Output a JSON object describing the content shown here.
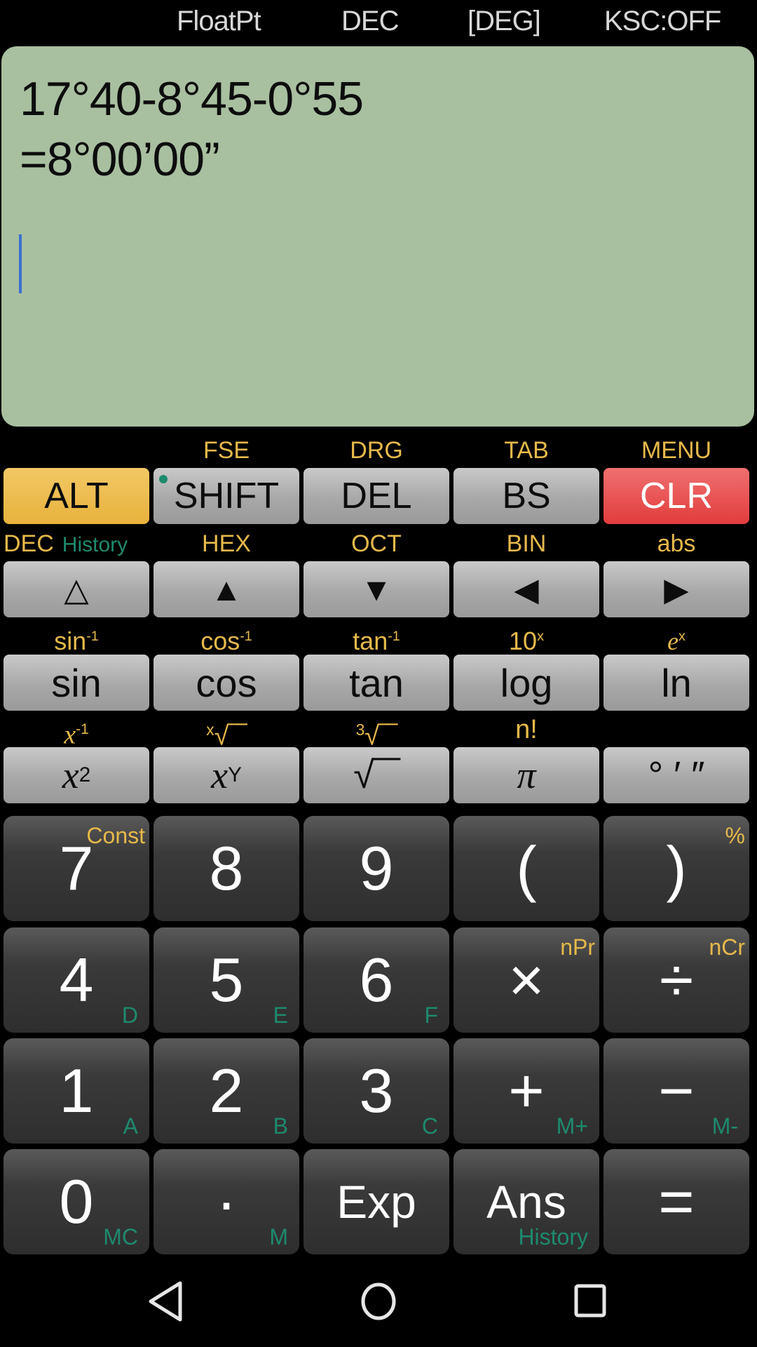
{
  "status_bar": {
    "float_mode": "FloatPt",
    "number_base": "DEC",
    "angle_mode": "[DEG]",
    "ksc": "KSC:OFF"
  },
  "display": {
    "expression": "17°40-8°45-0°55",
    "result": "=8°00’00”"
  },
  "colors": {
    "display_bg": "#a8c0a0",
    "alt_key": "#e8b23c",
    "clr_key": "#e23c3c",
    "gold_label": "#e6b94a",
    "teal_label": "#1d8a6e",
    "cursor": "#3a6fd0"
  },
  "row1": {
    "labels": [
      "",
      "FSE",
      "DRG",
      "TAB",
      "MENU"
    ],
    "keys": [
      "ALT",
      "SHIFT",
      "DEL",
      "BS",
      "CLR"
    ]
  },
  "row2": {
    "labels": [
      "DEC",
      "HEX",
      "OCT",
      "BIN",
      "abs"
    ],
    "label_extra": "History",
    "keys": [
      "△",
      "▲",
      "▼",
      "◀",
      "▶"
    ],
    "icons": [
      "outline-up-triangle-icon",
      "up-arrow-icon",
      "down-arrow-icon",
      "left-arrow-icon",
      "right-arrow-icon"
    ]
  },
  "row3": {
    "labels": [
      {
        "base": "sin",
        "sup": "-1"
      },
      {
        "base": "cos",
        "sup": "-1"
      },
      {
        "base": "tan",
        "sup": "-1"
      },
      {
        "base": "10",
        "sup": "x"
      },
      {
        "base": "e",
        "sup": "x"
      }
    ],
    "keys": [
      "sin",
      "cos",
      "tan",
      "log",
      "ln"
    ]
  },
  "row4": {
    "labels": [
      {
        "base": "x",
        "sup": "-1"
      },
      {
        "pre": "x",
        "base": "√‾‾"
      },
      {
        "pre": "3",
        "base": "√‾‾"
      },
      {
        "base": "n!"
      },
      {
        "base": ""
      }
    ],
    "keys": [
      {
        "base": "x",
        "sup": "2"
      },
      {
        "base": "x",
        "sup": "Y"
      },
      {
        "base": "√‾‾"
      },
      {
        "base": "π"
      },
      {
        "base": "° ′ ″"
      }
    ]
  },
  "digits": [
    [
      {
        "main": "7",
        "gold": "Const",
        "teal": ""
      },
      {
        "main": "8",
        "gold": "",
        "teal": ""
      },
      {
        "main": "9",
        "gold": "",
        "teal": ""
      },
      {
        "main": "(",
        "gold": "",
        "teal": ""
      },
      {
        "main": ")",
        "gold": "%",
        "teal": ""
      }
    ],
    [
      {
        "main": "4",
        "gold": "",
        "teal": "D"
      },
      {
        "main": "5",
        "gold": "",
        "teal": "E"
      },
      {
        "main": "6",
        "gold": "",
        "teal": "F"
      },
      {
        "main": "×",
        "gold": "nPr",
        "teal": ""
      },
      {
        "main": "÷",
        "gold": "nCr",
        "teal": ""
      }
    ],
    [
      {
        "main": "1",
        "gold": "",
        "teal": "A"
      },
      {
        "main": "2",
        "gold": "",
        "teal": "B"
      },
      {
        "main": "3",
        "gold": "",
        "teal": "C"
      },
      {
        "main": "+",
        "gold": "",
        "teal": "M+"
      },
      {
        "main": "−",
        "gold": "",
        "teal": "M-"
      }
    ],
    [
      {
        "main": "0",
        "gold": "",
        "teal": "MC"
      },
      {
        "main": "·",
        "gold": "",
        "teal": "M"
      },
      {
        "main": "Exp",
        "gold": "",
        "teal": ""
      },
      {
        "main": "Ans",
        "gold": "",
        "teal": "History"
      },
      {
        "main": "=",
        "gold": "",
        "teal": ""
      }
    ]
  ],
  "nav": {
    "back": "back-icon",
    "home": "home-icon",
    "recents": "recents-icon"
  }
}
